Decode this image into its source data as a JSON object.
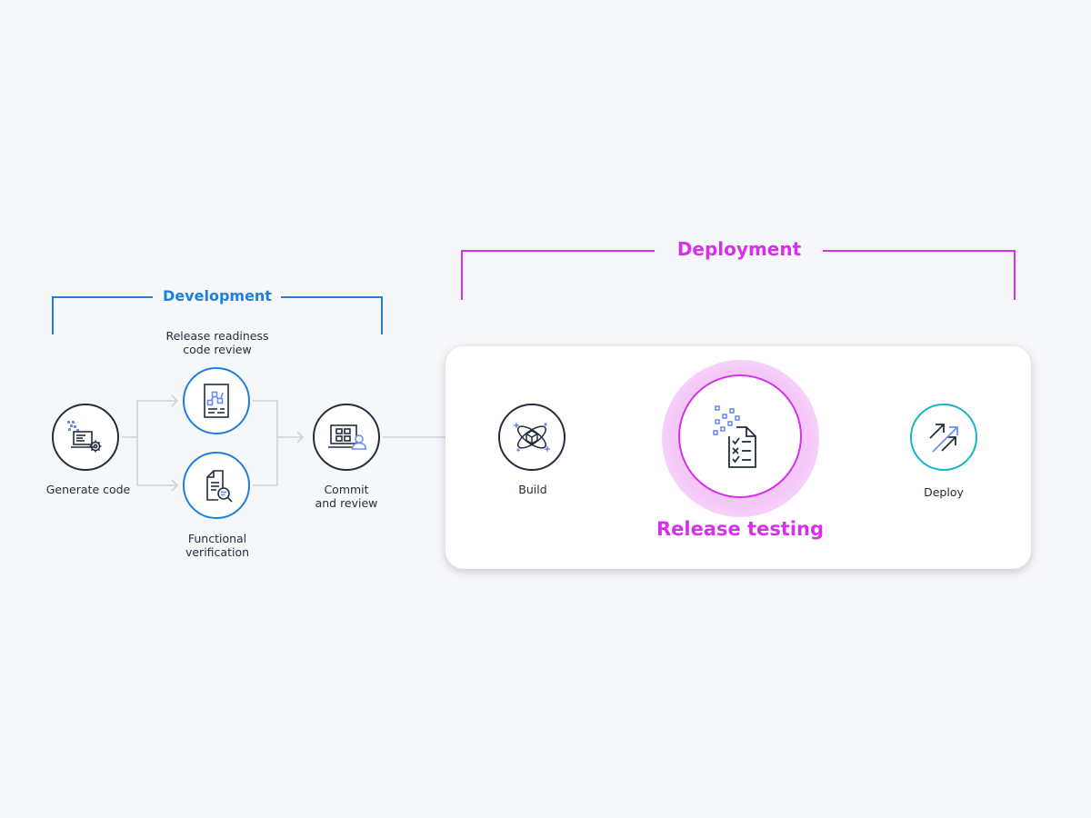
{
  "groups": {
    "development": "Development",
    "deployment": "Deployment"
  },
  "nodes": {
    "generate_code": "Generate code",
    "release_readiness": [
      "Release readiness",
      "code review"
    ],
    "functional_verification": [
      "Functional",
      "verification"
    ],
    "commit_review": [
      "Commit",
      "and review"
    ],
    "build": "Build",
    "release_testing": "Release testing",
    "deploy": "Deploy"
  },
  "colors": {
    "development_accent": "#1f7fe0",
    "deployment_accent": "#d631ea",
    "deploy_accent": "#17b3c8",
    "node_border": "#232f3e",
    "connector": "#c9d2de",
    "background": "#f6f7f9"
  },
  "icons": {
    "generate_code": "laptop-gear-icon",
    "release_readiness": "document-flow-icon",
    "functional_verification": "document-search-icon",
    "commit_review": "laptop-grid-user-icon",
    "build": "atom-cube-icon",
    "release_testing": "checklist-document-icon",
    "deploy": "double-arrow-up-icon"
  }
}
